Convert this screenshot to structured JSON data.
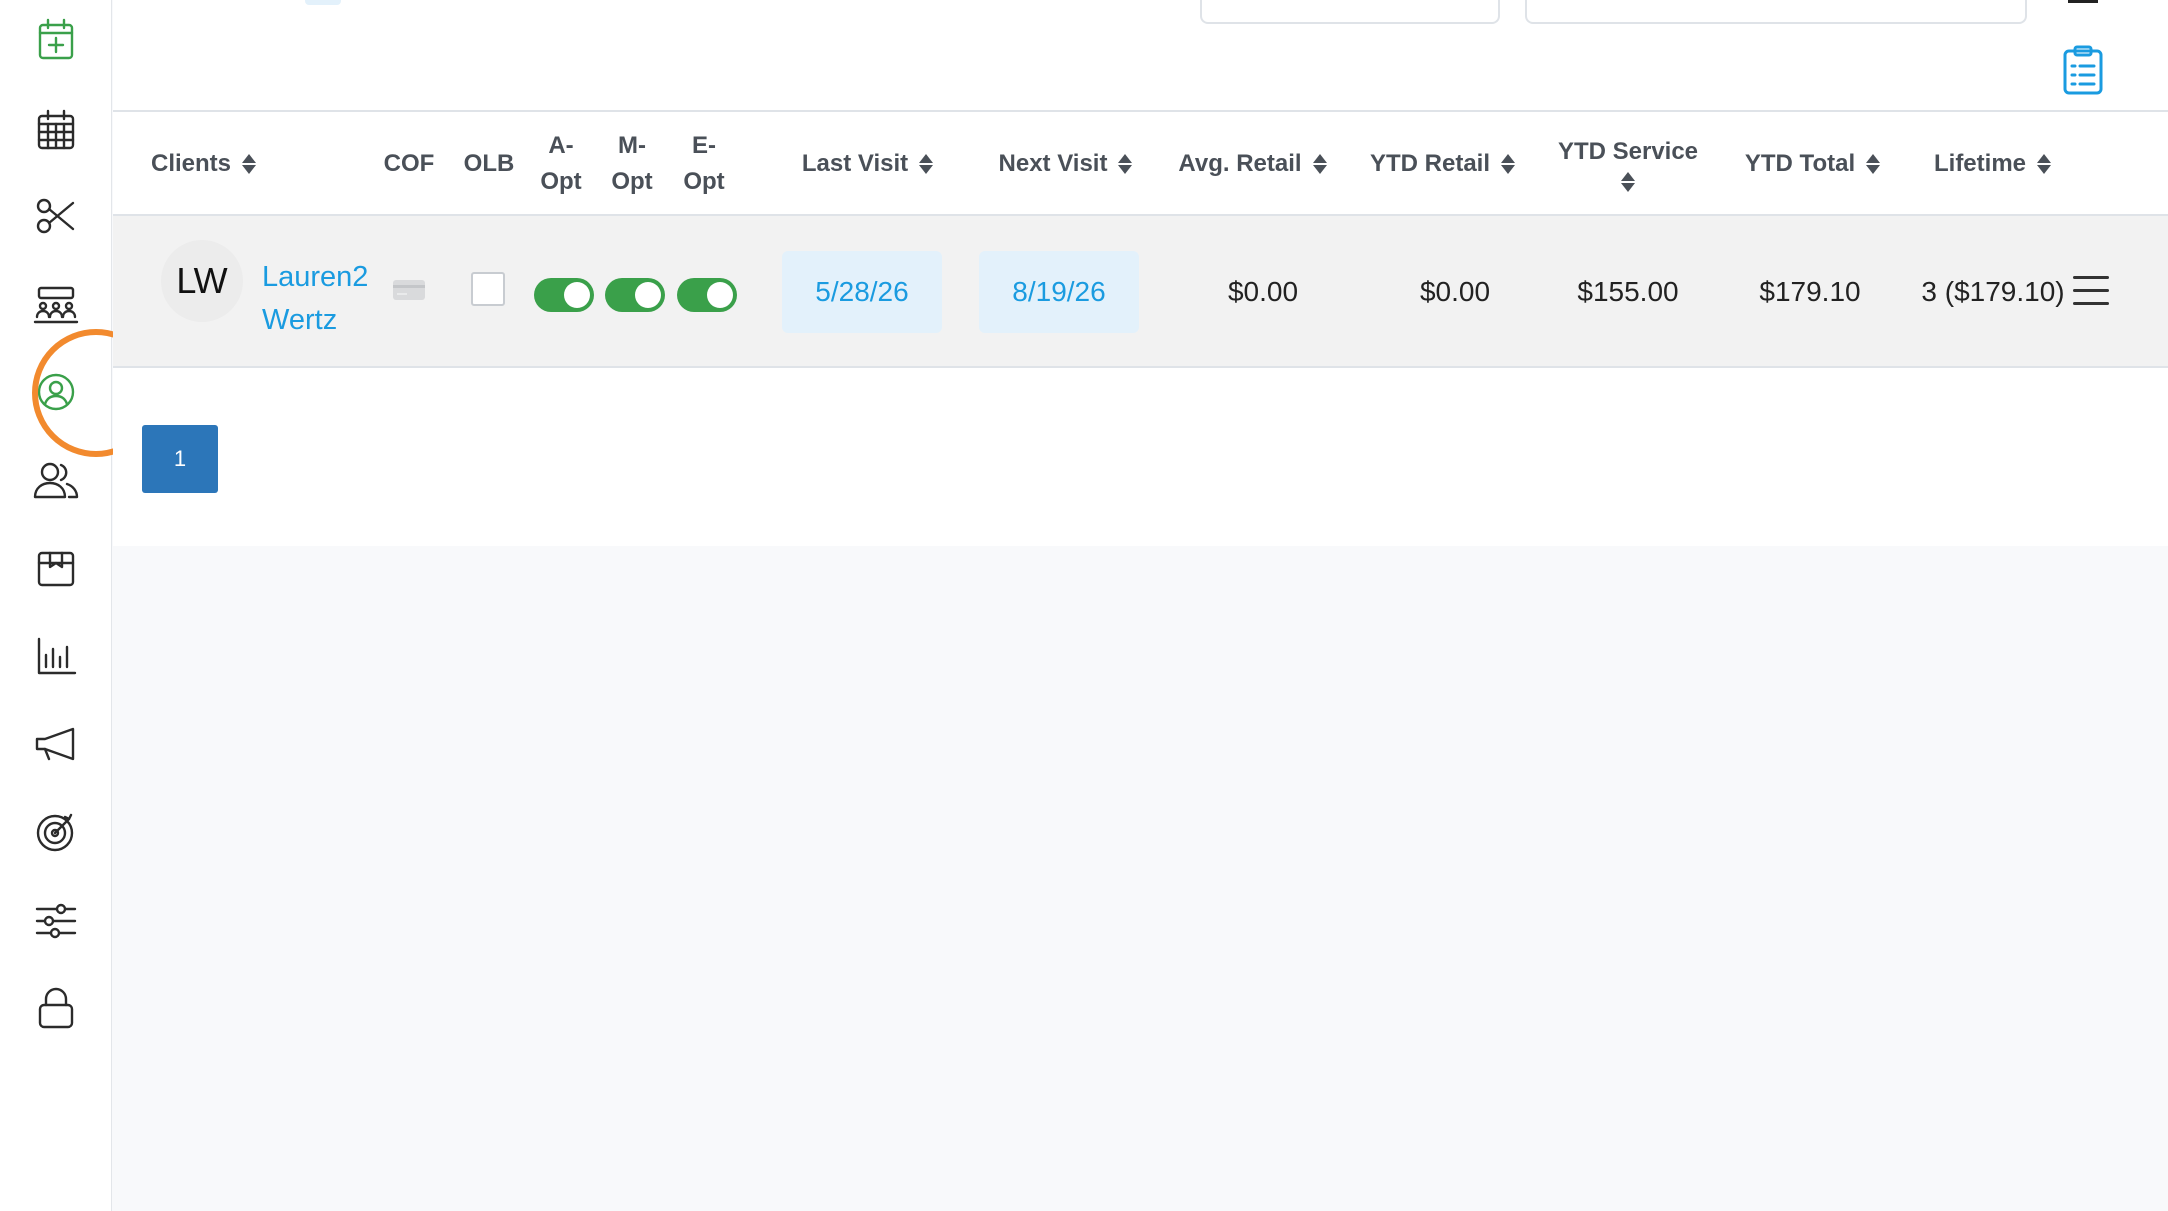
{
  "sidebar": {
    "items": [
      {
        "name": "add-appointment",
        "icon": "calendar-plus-icon"
      },
      {
        "name": "calendar",
        "icon": "calendar-grid-icon"
      },
      {
        "name": "services",
        "icon": "scissors-icon"
      },
      {
        "name": "staff",
        "icon": "group-grid-icon"
      },
      {
        "name": "clients",
        "icon": "user-circle-icon",
        "active": true
      },
      {
        "name": "users",
        "icon": "users-icon"
      },
      {
        "name": "products",
        "icon": "box-icon"
      },
      {
        "name": "reports",
        "icon": "bar-chart-icon"
      },
      {
        "name": "marketing",
        "icon": "megaphone-icon"
      },
      {
        "name": "goals",
        "icon": "target-icon"
      },
      {
        "name": "settings",
        "icon": "sliders-icon"
      },
      {
        "name": "lock",
        "icon": "lock-icon"
      }
    ],
    "active_color": "#3aa04a",
    "highlight_color": "#f28a2e"
  },
  "table": {
    "headers": {
      "clients": "Clients",
      "cof": "COF",
      "olb": "OLB",
      "a_opt_1": "A-",
      "a_opt_2": "Opt",
      "m_opt_1": "M-",
      "m_opt_2": "Opt",
      "e_opt_1": "E-",
      "e_opt_2": "Opt",
      "last_visit": "Last Visit",
      "next_visit": "Next Visit",
      "avg_retail": "Avg. Retail",
      "ytd_retail": "YTD Retail",
      "ytd_service": "YTD Service",
      "ytd_total": "YTD Total",
      "lifetime": "Lifetime"
    },
    "rows": [
      {
        "initials": "LW",
        "name": "Lauren2 Wertz",
        "olb_checked": false,
        "a_opt": true,
        "m_opt": true,
        "e_opt": true,
        "last_visit": "5/28/26",
        "next_visit": "8/19/26",
        "avg_retail": "$0.00",
        "ytd_retail": "$0.00",
        "ytd_service": "$155.00",
        "ytd_total": "$179.10",
        "lifetime": "3 ($179.10)"
      }
    ]
  },
  "pagination": {
    "current_page": "1"
  },
  "colors": {
    "link": "#1a9be0",
    "toggle_on": "#3aa04a",
    "page_button": "#2c76b9"
  }
}
